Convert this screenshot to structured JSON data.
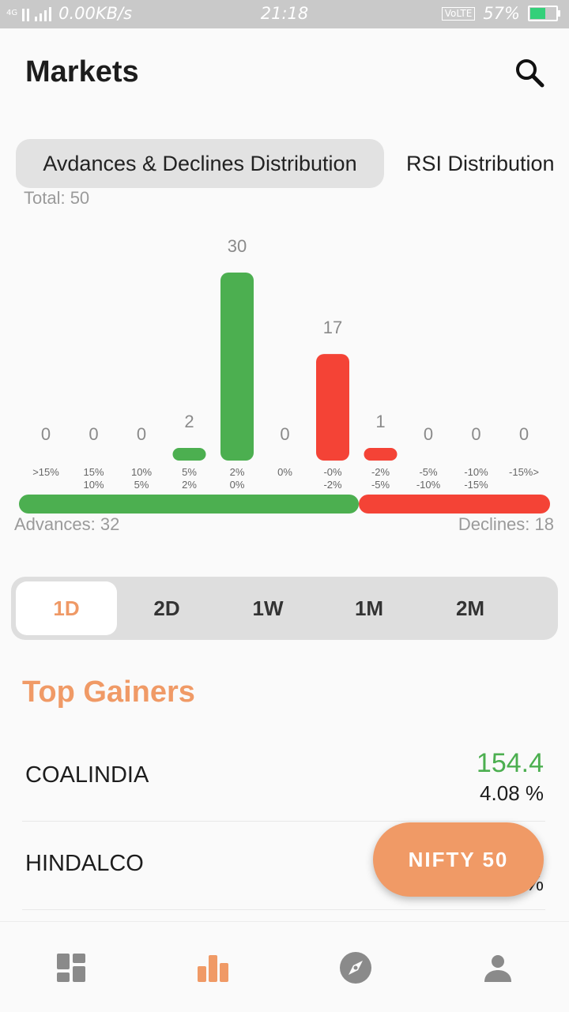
{
  "status_bar": {
    "network": "4G",
    "speed": "0.00KB/s",
    "time": "21:18",
    "volte": "VoLTE",
    "battery": "57%"
  },
  "header": {
    "title": "Markets"
  },
  "dist_tabs": [
    {
      "label": "Avdances & Declines Distribution"
    },
    {
      "label": "RSI Distribution"
    }
  ],
  "total": "Total: 50",
  "chart_data": {
    "type": "bar",
    "categories": [
      ">15%",
      "15% 10%",
      "10% 5%",
      "5% 2%",
      "2% 0%",
      "0%",
      "-0% -2%",
      "-2% -5%",
      "-5% -10%",
      "-10% -15%",
      "-15%>"
    ],
    "category_lines": [
      [
        ">15%"
      ],
      [
        "15%",
        "10%"
      ],
      [
        "10%",
        "5%"
      ],
      [
        "5%",
        "2%"
      ],
      [
        "2%",
        "0%"
      ],
      [
        "0%"
      ],
      [
        "-0%",
        "-2%"
      ],
      [
        "-2%",
        "-5%"
      ],
      [
        "-5%",
        "-10%"
      ],
      [
        "-10%",
        "-15%"
      ],
      [
        "-15%>"
      ]
    ],
    "values": [
      0,
      0,
      0,
      2,
      30,
      0,
      17,
      1,
      0,
      0,
      0
    ],
    "colors": [
      "#4caf50",
      "#4caf50",
      "#4caf50",
      "#4caf50",
      "#4caf50",
      "#4caf50",
      "#f44336",
      "#f44336",
      "#f44336",
      "#f44336",
      "#f44336"
    ],
    "ylim": [
      0,
      30
    ]
  },
  "breadth": {
    "advances": 32,
    "declines": 18,
    "advances_label": "Advances: 32",
    "declines_label": "Declines: 18",
    "advance_color": "#4caf50",
    "decline_color": "#f44336"
  },
  "periods": [
    {
      "label": "1D",
      "active": true
    },
    {
      "label": "2D"
    },
    {
      "label": "1W"
    },
    {
      "label": "1M"
    },
    {
      "label": "2M"
    }
  ],
  "section": {
    "title": "Top Gainers"
  },
  "gainers": [
    {
      "symbol": "COALINDIA",
      "price": "154.4",
      "change": "4.08 %"
    },
    {
      "symbol": "HINDALCO",
      "price": "",
      "change": "%"
    }
  ],
  "fab": {
    "label": "NIFTY 50"
  },
  "bottom_nav": [
    {
      "icon": "dashboard-icon"
    },
    {
      "icon": "bar-chart-icon",
      "active": true
    },
    {
      "icon": "compass-icon"
    },
    {
      "icon": "person-icon"
    }
  ],
  "colors": {
    "accent": "#f09a66",
    "gain": "#4caf50",
    "loss": "#f44336",
    "nav_inactive": "#8a8a8a"
  }
}
